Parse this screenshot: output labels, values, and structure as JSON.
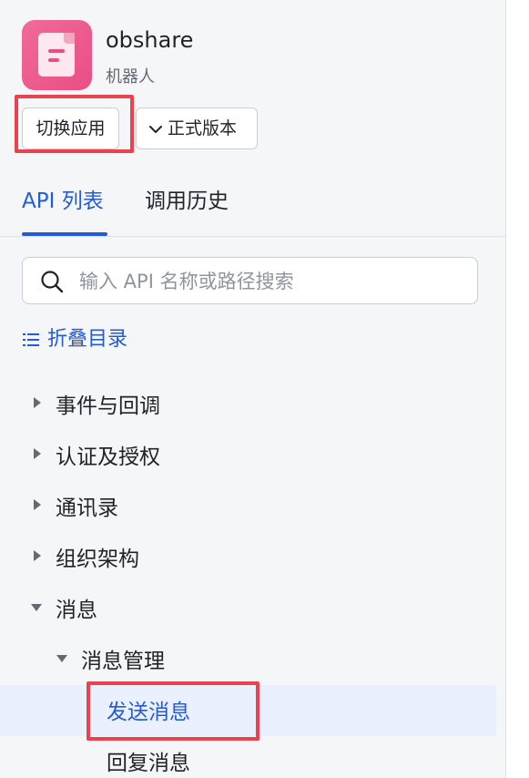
{
  "app": {
    "name": "obshare",
    "subtitle": "机器人",
    "icon": "document-icon",
    "brand_color": "#ea4e84"
  },
  "toolbar": {
    "switch_label": "切换应用",
    "version_label": "正式版本"
  },
  "tabs": [
    {
      "label": "API 列表",
      "active": true
    },
    {
      "label": "调用历史",
      "active": false
    }
  ],
  "search": {
    "placeholder": "输入 API 名称或路径搜索",
    "value": ""
  },
  "collapse_label": "折叠目录",
  "tree": {
    "items": [
      {
        "label": "事件与回调",
        "expanded": false
      },
      {
        "label": "认证及授权",
        "expanded": false
      },
      {
        "label": "通讯录",
        "expanded": false
      },
      {
        "label": "组织架构",
        "expanded": false
      },
      {
        "label": "消息",
        "expanded": true
      }
    ],
    "message_children": [
      {
        "label": "消息管理",
        "expanded": true
      }
    ],
    "message_mgmt_children": [
      {
        "label": "发送消息",
        "selected": true
      },
      {
        "label": "回复消息",
        "selected": false
      }
    ]
  },
  "colors": {
    "accent": "#245bdb",
    "highlight_box": "#e8434f",
    "selected_row": "#eaf0fd"
  }
}
